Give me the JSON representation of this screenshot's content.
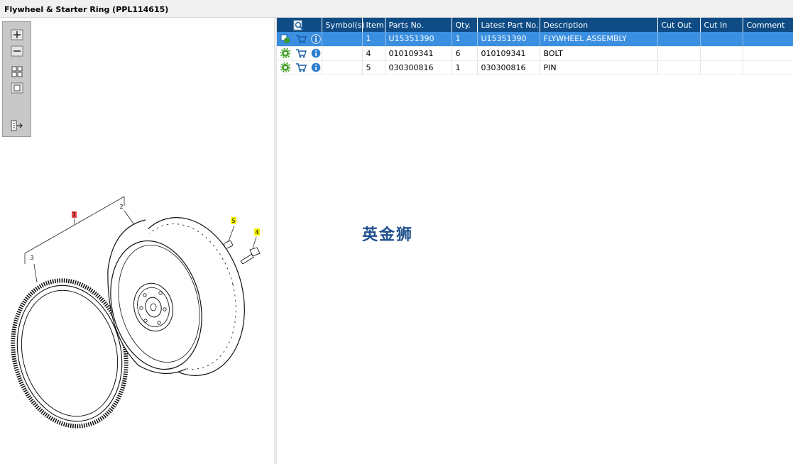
{
  "window": {
    "title": "Flywheel & Starter Ring (PPL114615)"
  },
  "toolbox": {
    "tools": [
      "zoom-in",
      "zoom-out",
      "fit-all",
      "fit-window",
      "export"
    ]
  },
  "drawing": {
    "callouts": {
      "c1": "1",
      "c2": "2",
      "c3": "3",
      "c4": "4",
      "c5": "5"
    }
  },
  "table": {
    "headers": [
      "",
      "Symbol(s)",
      "Item",
      "Parts No.",
      "Qty.",
      "Latest Part No.",
      "Description",
      "Cut Out",
      "Cut In",
      "Comment"
    ],
    "rows": [
      {
        "symbols": "",
        "item": "1",
        "parts_no": "U15351390",
        "qty": "1",
        "latest_part_no": "U15351390",
        "description": "FLYWHEEL ASSEMBLY",
        "cut_out": "",
        "cut_in": "",
        "comment": "",
        "selected": true
      },
      {
        "symbols": "",
        "item": "4",
        "parts_no": "010109341",
        "qty": "6",
        "latest_part_no": "010109341",
        "description": "BOLT",
        "cut_out": "",
        "cut_in": "",
        "comment": "",
        "selected": false
      },
      {
        "symbols": "",
        "item": "5",
        "parts_no": "030300816",
        "qty": "1",
        "latest_part_no": "030300816",
        "description": "PIN",
        "cut_out": "",
        "cut_in": "",
        "comment": "",
        "selected": false
      }
    ]
  },
  "watermark": "英金狮",
  "colors": {
    "header_bg": "#0f4c86",
    "selected_row": "#3b8fe0",
    "callout_yellow": "#f5f500",
    "callout_red": "#f04a4a"
  }
}
